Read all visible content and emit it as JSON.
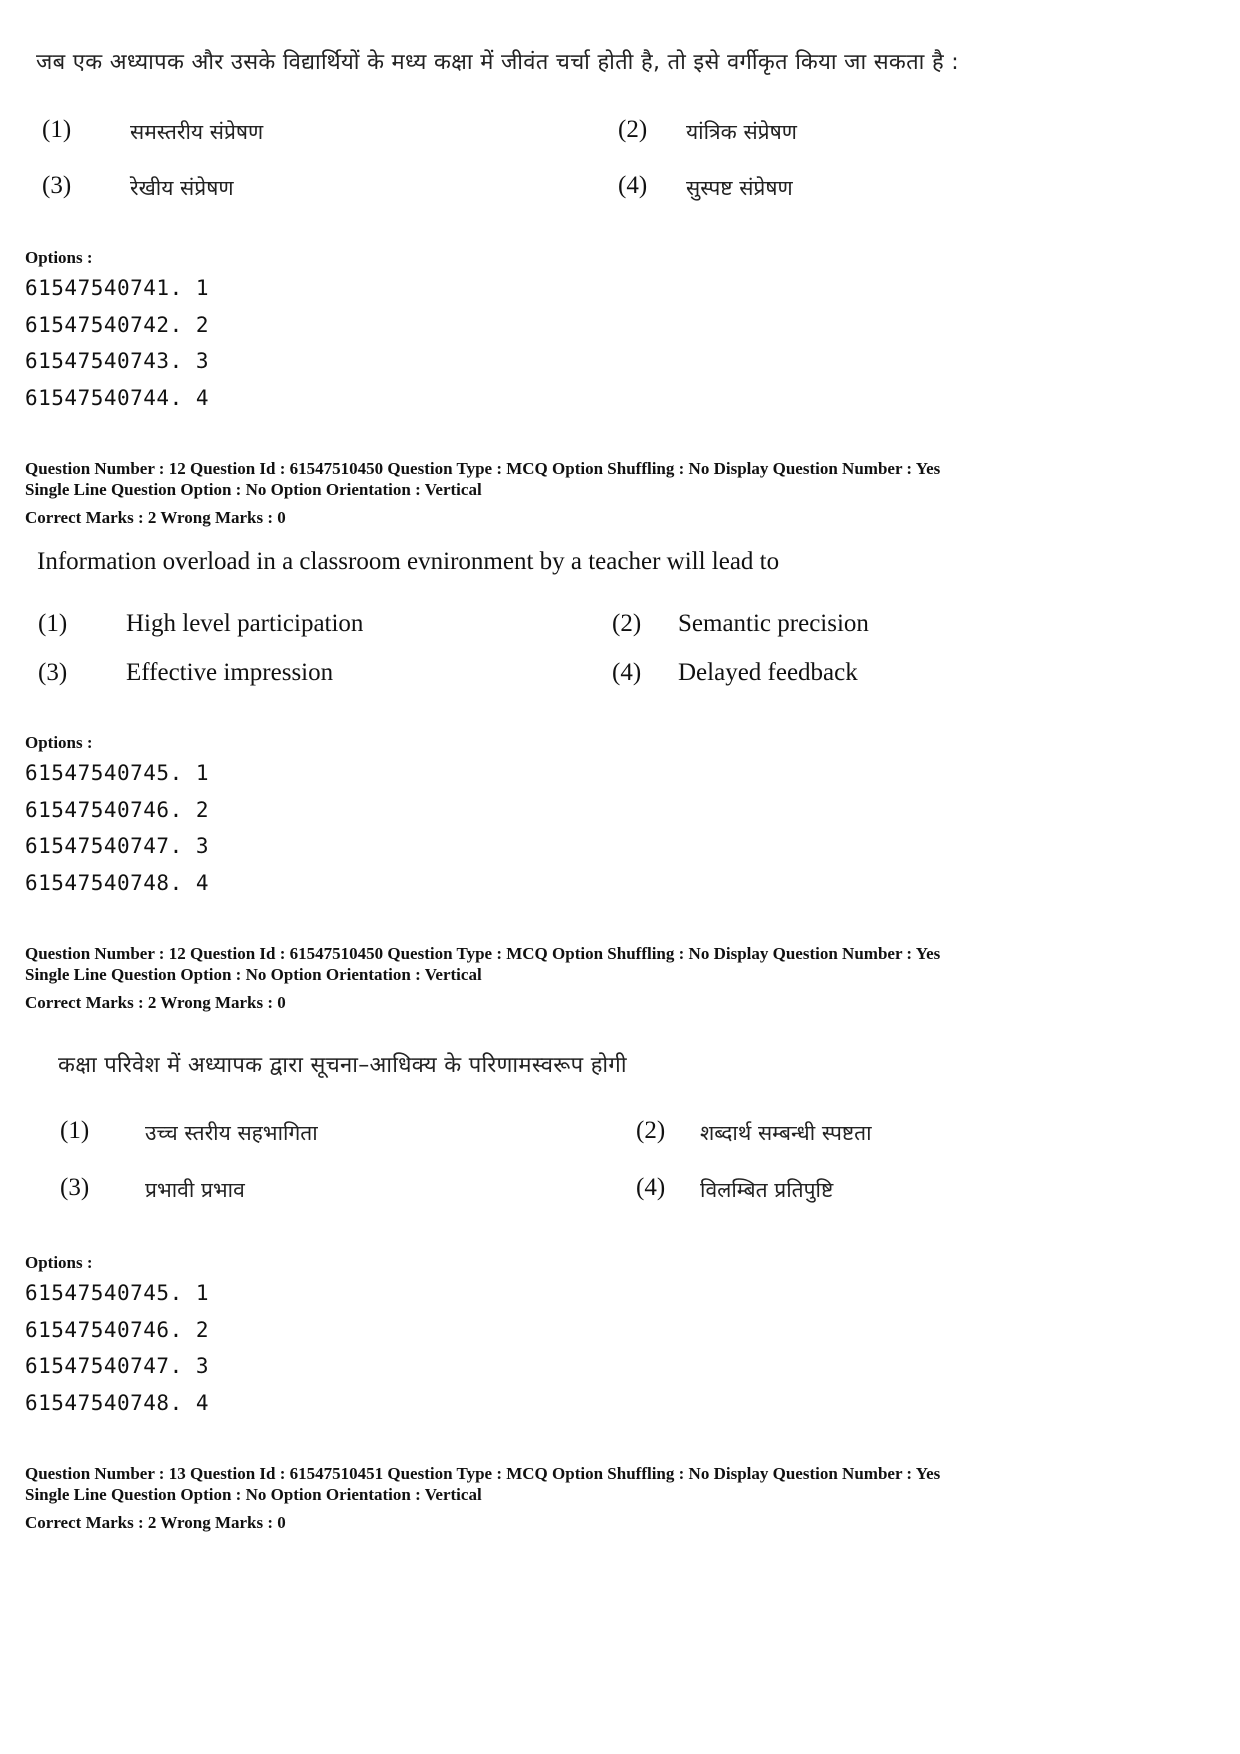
{
  "blocks": [
    {
      "question": {
        "text": "जब एक अध्यापक और उसके विद्यार्थियों के मध्य कक्षा में जीवंत चर्चा होती है, तो इसे वर्गीकृत किया जा सकता है :",
        "options": [
          {
            "num": "(1)",
            "text": "समस्तरीय संप्रेषण"
          },
          {
            "num": "(2)",
            "text": "यांत्रिक संप्रेषण"
          },
          {
            "num": "(3)",
            "text": "रेखीय संप्रेषण"
          },
          {
            "num": "(4)",
            "text": "सुस्पष्ट संप्रेषण"
          }
        ]
      },
      "options_label": "Options :",
      "choices": [
        "61547540741. 1",
        "61547540742. 2",
        "61547540743. 3",
        "61547540744. 4"
      ]
    },
    {
      "meta": {
        "line1": "Question Number : 12  Question Id : 61547510450  Question Type : MCQ  Option Shuffling : No  Display Question Number : Yes",
        "line2": "Single Line Question Option : No  Option Orientation : Vertical",
        "line3": "Correct Marks : 2  Wrong Marks : 0"
      },
      "question": {
        "text": "Information overload in a classroom evnironment by a teacher will lead to",
        "options": [
          {
            "num": "(1)",
            "text": "High level participation"
          },
          {
            "num": "(2)",
            "text": "Semantic precision"
          },
          {
            "num": "(3)",
            "text": "Effective impression"
          },
          {
            "num": "(4)",
            "text": "Delayed feedback"
          }
        ]
      },
      "options_label": "Options :",
      "choices": [
        "61547540745. 1",
        "61547540746. 2",
        "61547540747. 3",
        "61547540748. 4"
      ]
    },
    {
      "meta": {
        "line1": "Question Number : 12  Question Id : 61547510450  Question Type : MCQ  Option Shuffling : No  Display Question Number : Yes",
        "line2": "Single Line Question Option : No  Option Orientation : Vertical",
        "line3": "Correct Marks : 2  Wrong Marks : 0"
      },
      "question": {
        "text": "कक्षा परिवेश में अध्यापक द्वारा सूचना–आधिक्य के परिणामस्वरूप होगी",
        "options": [
          {
            "num": "(1)",
            "text": "उच्च स्तरीय सहभागिता"
          },
          {
            "num": "(2)",
            "text": "शब्दार्थ सम्बन्धी स्पष्टता"
          },
          {
            "num": "(3)",
            "text": "प्रभावी प्रभाव"
          },
          {
            "num": "(4)",
            "text": "विलम्बित प्रतिपुष्टि"
          }
        ]
      },
      "options_label": "Options :",
      "choices": [
        "61547540745. 1",
        "61547540746. 2",
        "61547540747. 3",
        "61547540748. 4"
      ]
    },
    {
      "meta": {
        "line1": "Question Number : 13  Question Id : 61547510451  Question Type : MCQ  Option Shuffling : No  Display Question Number : Yes",
        "line2": "Single Line Question Option : No  Option Orientation : Vertical",
        "line3": "Correct Marks : 2  Wrong Marks : 0"
      }
    }
  ]
}
